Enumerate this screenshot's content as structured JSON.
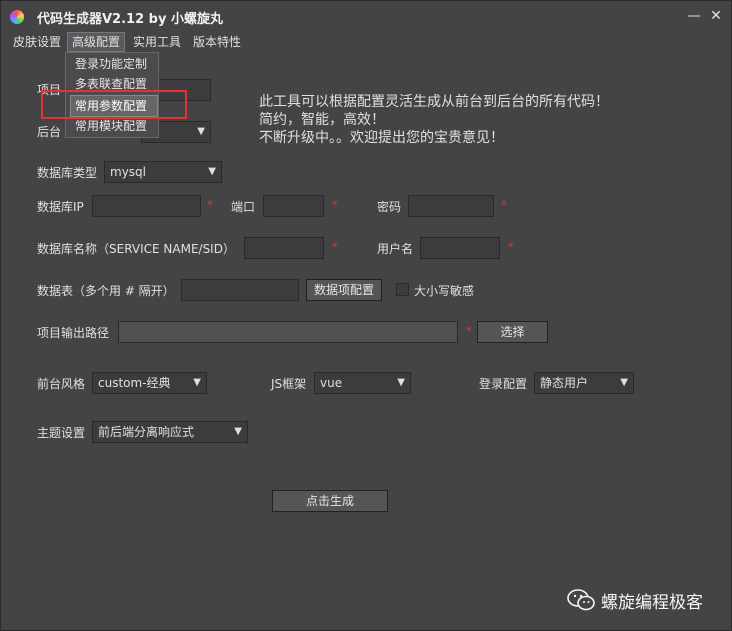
{
  "window": {
    "title": "代码生成器V2.12 by 小螺旋丸",
    "minimize_glyph": "—",
    "close_glyph": "✕"
  },
  "menubar": {
    "items": [
      "皮肤设置",
      "高级配置",
      "实用工具",
      "版本特性"
    ]
  },
  "dropdown": {
    "items": [
      "登录功能定制",
      "多表联查配置",
      "常用参数配置",
      "常用模块配置"
    ]
  },
  "info": {
    "lines": [
      "此工具可以根据配置灵活生成从前台到后台的所有代码！",
      "简约，智能，高效！",
      "不断升级中。。欢迎提出您的宝贵意见！"
    ]
  },
  "form": {
    "project_label": "项目",
    "backend_label": "后台",
    "db_type_label": "数据库类型",
    "db_type_value": "mysql",
    "db_ip_label": "数据库IP",
    "port_label": "端口",
    "password_label": "密码",
    "db_name_label": "数据库名称（SERVICE NAME/SID）",
    "username_label": "用户名",
    "tables_label": "数据表（多个用 # 隔开）",
    "field_config_button": "数据项配置",
    "case_sensitive_label": "大小写敏感",
    "output_path_label": "项目输出路径",
    "choose_button": "选择",
    "front_style_label": "前台风格",
    "front_style_value": "custom-经典",
    "js_framework_label": "JS框架",
    "js_framework_value": "vue",
    "login_config_label": "登录配置",
    "login_config_value": "静态用户",
    "theme_label": "主题设置",
    "theme_value": "前后端分离响应式",
    "generate_button": "点击生成",
    "required_mark": "*"
  },
  "watermark": {
    "text": "螺旋编程极客"
  }
}
